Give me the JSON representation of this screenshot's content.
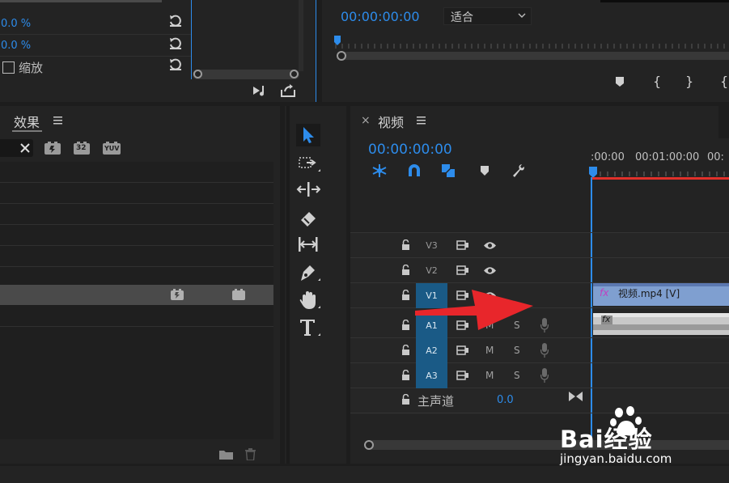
{
  "effect_controls": {
    "rows": [
      {
        "value": "0.0 %"
      },
      {
        "value": "0.0 %"
      }
    ],
    "scale_checkbox_label": "缩放",
    "scale_checked": false
  },
  "program_monitor": {
    "timecode": "00:00:00:00",
    "fit_label": "适合"
  },
  "effects_panel": {
    "title": "效果",
    "menu_icon": "hamburger-menu-icon",
    "badges": [
      "32",
      "YUV"
    ]
  },
  "timeline": {
    "close": "×",
    "title": "视频",
    "timecode": "00:00:00:00",
    "ruler_labels": [
      ":00:00",
      "00:01:00:00",
      "00:"
    ],
    "tracks": [
      {
        "id": "V3"
      },
      {
        "id": "V2"
      },
      {
        "id": "V1"
      },
      {
        "id": "A1",
        "m": "M",
        "s": "S"
      },
      {
        "id": "A2",
        "m": "M",
        "s": "S"
      },
      {
        "id": "A3",
        "m": "M",
        "s": "S"
      }
    ],
    "master_label": "主声道",
    "master_value": "0.0",
    "clip_video_label": "视频.mp4 [V]",
    "fx_label": "fx"
  },
  "watermark": {
    "text": "Bai经验",
    "url": "jingyan.baidu.com"
  },
  "colors": {
    "accent_blue": "#2d8ceb",
    "track_target": "#1a5a86",
    "clip_video": "#7f9fd0",
    "playhead_red": "#e0302a",
    "arrow_red": "#e8262b"
  }
}
